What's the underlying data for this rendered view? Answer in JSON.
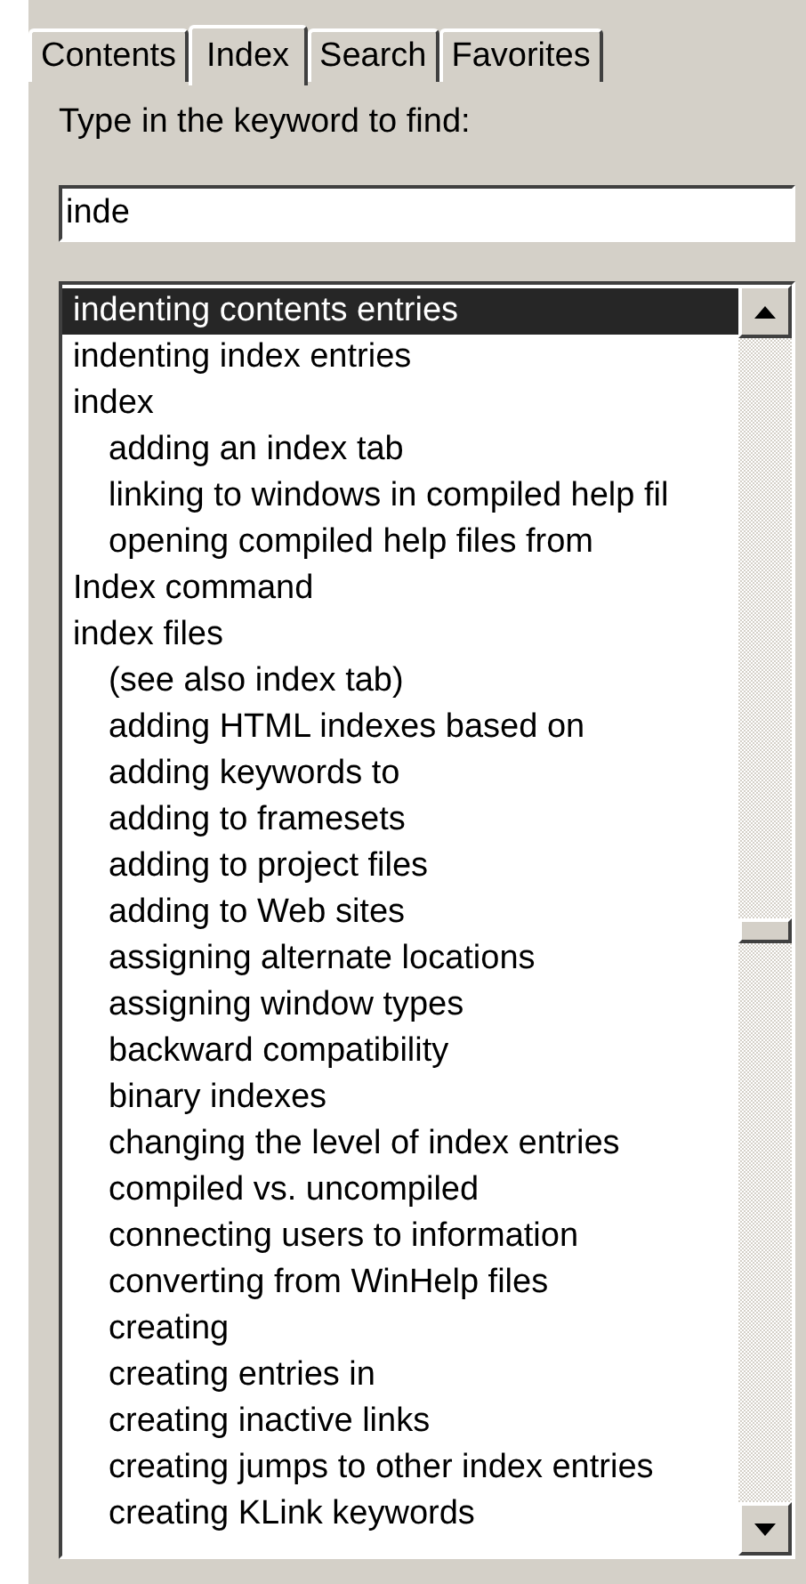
{
  "tabs": [
    {
      "label": "Contents",
      "selected": false
    },
    {
      "label": "Index",
      "selected": true
    },
    {
      "label": "Search",
      "selected": false
    },
    {
      "label": "Favorites",
      "selected": false
    }
  ],
  "keyword_label": "Type in the keyword to find:",
  "keyword_field": {
    "value": "inde"
  },
  "index_list": [
    {
      "label": "indenting contents entries",
      "selected": true
    },
    {
      "label": "indenting index entries",
      "selected": false
    },
    {
      "label": "index",
      "selected": false,
      "children": [
        {
          "label": "adding an index tab",
          "selected": false
        },
        {
          "label": "linking to windows in compiled help fil",
          "selected": false
        },
        {
          "label": "opening compiled help files from",
          "selected": false
        }
      ]
    },
    {
      "label": "Index command",
      "selected": false
    },
    {
      "label": "index files",
      "selected": false,
      "children": [
        {
          "label": "(see also index tab)",
          "selected": false
        },
        {
          "label": "adding HTML indexes based on",
          "selected": false
        },
        {
          "label": "adding keywords to",
          "selected": false
        },
        {
          "label": "adding to framesets",
          "selected": false
        },
        {
          "label": "adding to project files",
          "selected": false
        },
        {
          "label": "adding to Web sites",
          "selected": false
        },
        {
          "label": "assigning alternate locations",
          "selected": false
        },
        {
          "label": "assigning window types",
          "selected": false
        },
        {
          "label": "backward compatibility",
          "selected": false
        },
        {
          "label": "binary indexes",
          "selected": false
        },
        {
          "label": "changing the level of index entries",
          "selected": false
        },
        {
          "label": "compiled vs. uncompiled",
          "selected": false
        },
        {
          "label": "connecting users to information",
          "selected": false
        },
        {
          "label": "converting from WinHelp files",
          "selected": false
        },
        {
          "label": "creating",
          "selected": false
        },
        {
          "label": "creating entries in",
          "selected": false
        },
        {
          "label": "creating inactive links",
          "selected": false
        },
        {
          "label": "creating jumps to other index entries",
          "selected": false
        },
        {
          "label": "creating KLink keywords",
          "selected": false
        }
      ]
    }
  ]
}
